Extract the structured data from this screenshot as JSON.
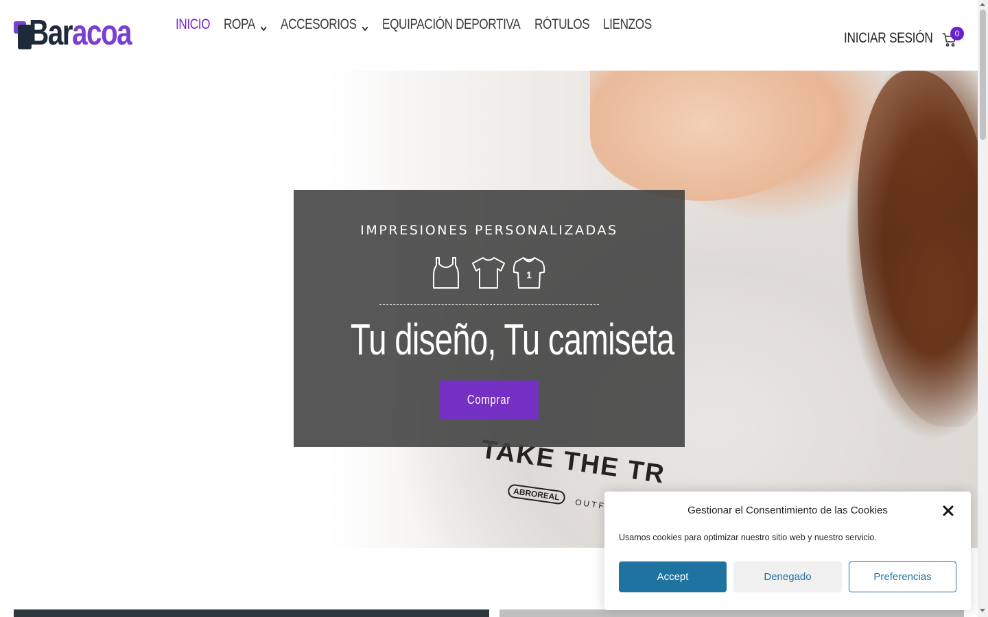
{
  "brand": {
    "logo_text_dark": "Bar",
    "logo_text_accent": "acoa",
    "accent_color": "#7a27c9",
    "dark_color": "#1d2a3a"
  },
  "nav": {
    "items": [
      {
        "label": "INICIO",
        "active": true,
        "has_dropdown": false
      },
      {
        "label": "ROPA",
        "active": false,
        "has_dropdown": true
      },
      {
        "label": "ACCESORIOS",
        "active": false,
        "has_dropdown": true
      },
      {
        "label": "EQUIPACIÓN DEPORTIVA",
        "active": false,
        "has_dropdown": false
      },
      {
        "label": "RÓTULOS",
        "active": false,
        "has_dropdown": false
      },
      {
        "label": "LIENZOS",
        "active": false,
        "has_dropdown": false
      }
    ]
  },
  "account": {
    "login_label": "INICIAR SESIÓN",
    "cart_icon": "shopping-cart-icon",
    "cart_count": "0"
  },
  "hero": {
    "kicker": "IMPRESIONES PERSONALIZADAS",
    "icons": [
      "tank-top-icon",
      "t-shirt-icon",
      "jersey-icon"
    ],
    "headline": "Tu diseño, Tu camiseta",
    "cta_label": "Comprar",
    "cta_color": "#7431c3",
    "photo_print": {
      "line1": "TAKE THE TR",
      "badge": "ABROREAL",
      "line2": "OUTFITTE"
    }
  },
  "cookie_banner": {
    "title": "Gestionar el Consentimiento de las Cookies",
    "text": "Usamos cookies para optimizar nuestro sitio web y nuestro servicio.",
    "accept_label": "Accept",
    "deny_label": "Denegado",
    "preferences_label": "Preferencias",
    "button_color": "#1e73a0"
  }
}
